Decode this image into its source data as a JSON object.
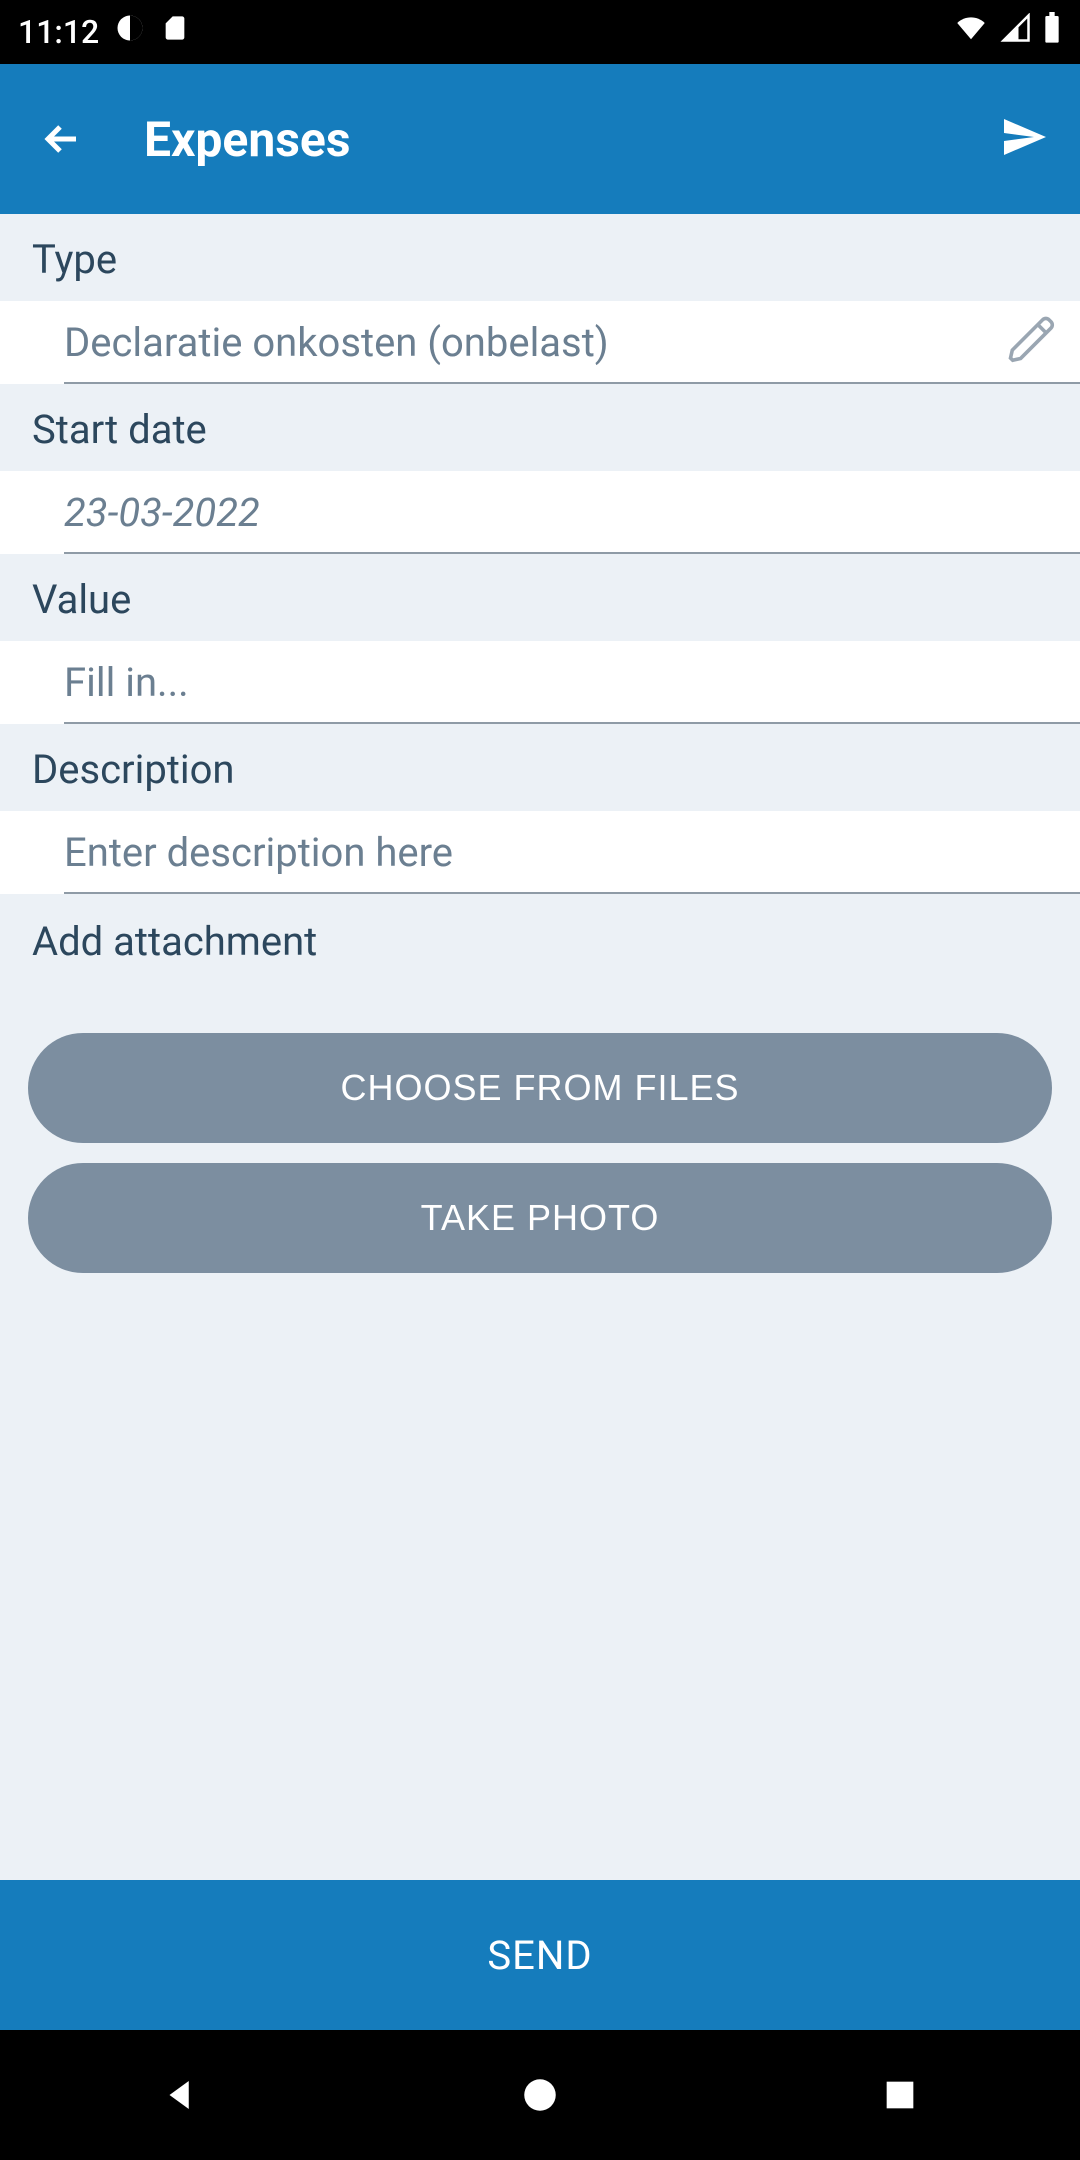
{
  "statusbar": {
    "time": "11:12"
  },
  "appbar": {
    "title": "Expenses"
  },
  "form": {
    "type_label": "Type",
    "type_value": "Declaratie onkosten (onbelast)",
    "startdate_label": "Start date",
    "startdate_value": "23-03-2022",
    "value_label": "Value",
    "value_placeholder": "Fill in...",
    "description_label": "Description",
    "description_placeholder": "Enter description here",
    "attachment_label": "Add attachment",
    "choose_files_label": "CHOOSE FROM FILES",
    "take_photo_label": "TAKE PHOTO"
  },
  "sendbar": {
    "label": "SEND"
  }
}
